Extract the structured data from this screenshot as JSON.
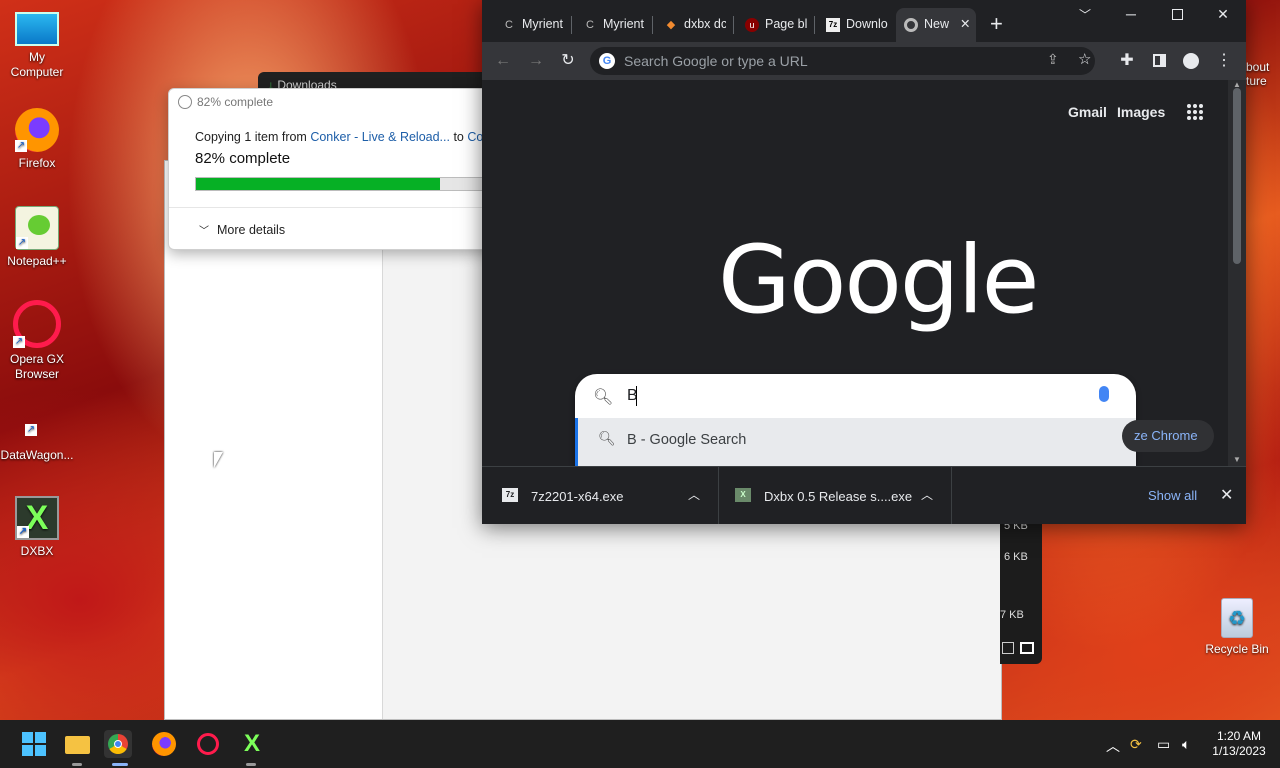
{
  "desktop": {
    "icons": [
      {
        "label": "My\nComputer"
      },
      {
        "label": "Firefox"
      },
      {
        "label": "Notepad++"
      },
      {
        "label": "Opera GX\nBrowser"
      },
      {
        "label": "DataWagon..."
      },
      {
        "label": "DXBX"
      },
      {
        "label": "Recycle Bin"
      }
    ],
    "edge_text": [
      "bout",
      "ture"
    ]
  },
  "explorer": {
    "title_partial": "Downloads",
    "sizes": [
      "5 KB",
      "6 KB",
      "7 KB"
    ]
  },
  "copy_dialog": {
    "header": "82% complete",
    "copying_prefix": "Copying 1 item from ",
    "source": "Conker - Live & Reload...",
    "to": " to ",
    "dest": "Conk",
    "percent_text": "82% complete",
    "progress": 82,
    "more_details": "More details"
  },
  "chrome": {
    "tabs": [
      {
        "title": "Myrient",
        "icon": "loading-icon"
      },
      {
        "title": "Myrient",
        "icon": "loading-icon"
      },
      {
        "title": "dxbx dc",
        "icon": "dxbx-icon"
      },
      {
        "title": "Page bl",
        "icon": "ublock-icon"
      },
      {
        "title": "Downlo",
        "icon": "7zip-icon"
      },
      {
        "title": "New",
        "icon": "chrome-icon",
        "active": true
      }
    ],
    "omnibox_placeholder": "Search Google or type a URL",
    "gmail": "Gmail",
    "images": "Images",
    "logo": "Google",
    "search_query": "B",
    "suggestion": "B - Google Search",
    "customize": "ze Chrome",
    "downloads": [
      {
        "name": "7z2201-x64.exe"
      },
      {
        "name": "Dxbx 0.5 Release s....exe"
      }
    ],
    "show_all": "Show all"
  },
  "taskbar": {
    "time": "1:20 AM",
    "date": "1/13/2023"
  },
  "colors": {
    "progress_green": "#06b025",
    "chrome_dark": "#202124",
    "link_blue": "#8ab4f8"
  }
}
